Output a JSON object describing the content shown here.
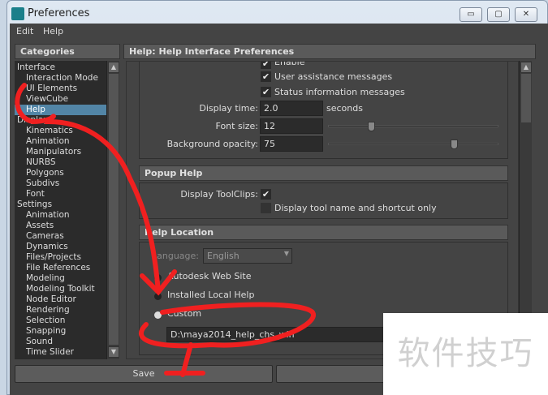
{
  "window": {
    "title": "Preferences",
    "minimize": "▭",
    "maximize": "▢",
    "close": "✕"
  },
  "menu": [
    "Edit",
    "Help"
  ],
  "categories": {
    "title": "Categories",
    "items": [
      {
        "label": "Interface",
        "level": 0
      },
      {
        "label": "Interaction Mode",
        "level": 1
      },
      {
        "label": "UI Elements",
        "level": 1
      },
      {
        "label": "ViewCube",
        "level": 1
      },
      {
        "label": "Help",
        "level": 1,
        "selected": true
      },
      {
        "label": "Display",
        "level": 0
      },
      {
        "label": "Kinematics",
        "level": 1
      },
      {
        "label": "Animation",
        "level": 1
      },
      {
        "label": "Manipulators",
        "level": 1
      },
      {
        "label": "NURBS",
        "level": 1
      },
      {
        "label": "Polygons",
        "level": 1
      },
      {
        "label": "Subdivs",
        "level": 1
      },
      {
        "label": "Font",
        "level": 1
      },
      {
        "label": "Settings",
        "level": 0
      },
      {
        "label": "Animation",
        "level": 1
      },
      {
        "label": "Assets",
        "level": 1
      },
      {
        "label": "Cameras",
        "level": 1
      },
      {
        "label": "Dynamics",
        "level": 1
      },
      {
        "label": "Files/Projects",
        "level": 1
      },
      {
        "label": "File References",
        "level": 1
      },
      {
        "label": "Modeling",
        "level": 1
      },
      {
        "label": "Modeling Toolkit",
        "level": 1
      },
      {
        "label": "Node Editor",
        "level": 1
      },
      {
        "label": "Rendering",
        "level": 1
      },
      {
        "label": "Selection",
        "level": 1
      },
      {
        "label": "Snapping",
        "level": 1
      },
      {
        "label": "Sound",
        "level": 1
      },
      {
        "label": "Time Slider",
        "level": 1
      }
    ]
  },
  "panel": {
    "title": "Help: Help Interface Preferences",
    "popup": {
      "enable": "Enable",
      "user_assist": "User assistance messages",
      "status_info": "Status information messages",
      "display_time_label": "Display time:",
      "display_time": "2.0",
      "seconds": "seconds",
      "font_size_label": "Font size:",
      "font_size": "12",
      "font_size_slider": 0.24,
      "bg_opacity_label": "Background opacity:",
      "bg_opacity": "75",
      "bg_opacity_slider": 0.75
    },
    "popup_help": {
      "title": "Popup Help",
      "toolclips_label": "Display ToolClips:",
      "tool_name": "Display tool name and shortcut only"
    },
    "location": {
      "title": "Help Location",
      "language_label": "Language:",
      "language": "English",
      "web": "Autodesk Web Site",
      "local": "Installed Local Help",
      "custom": "Custom",
      "custom_path": "D:\\maya2014_help_chs_win"
    }
  },
  "buttons": {
    "save": "Save"
  },
  "watermark": "软件技巧",
  "check": "✔",
  "colors": {
    "selection": "#5285a6",
    "annotation": "#f02020"
  }
}
